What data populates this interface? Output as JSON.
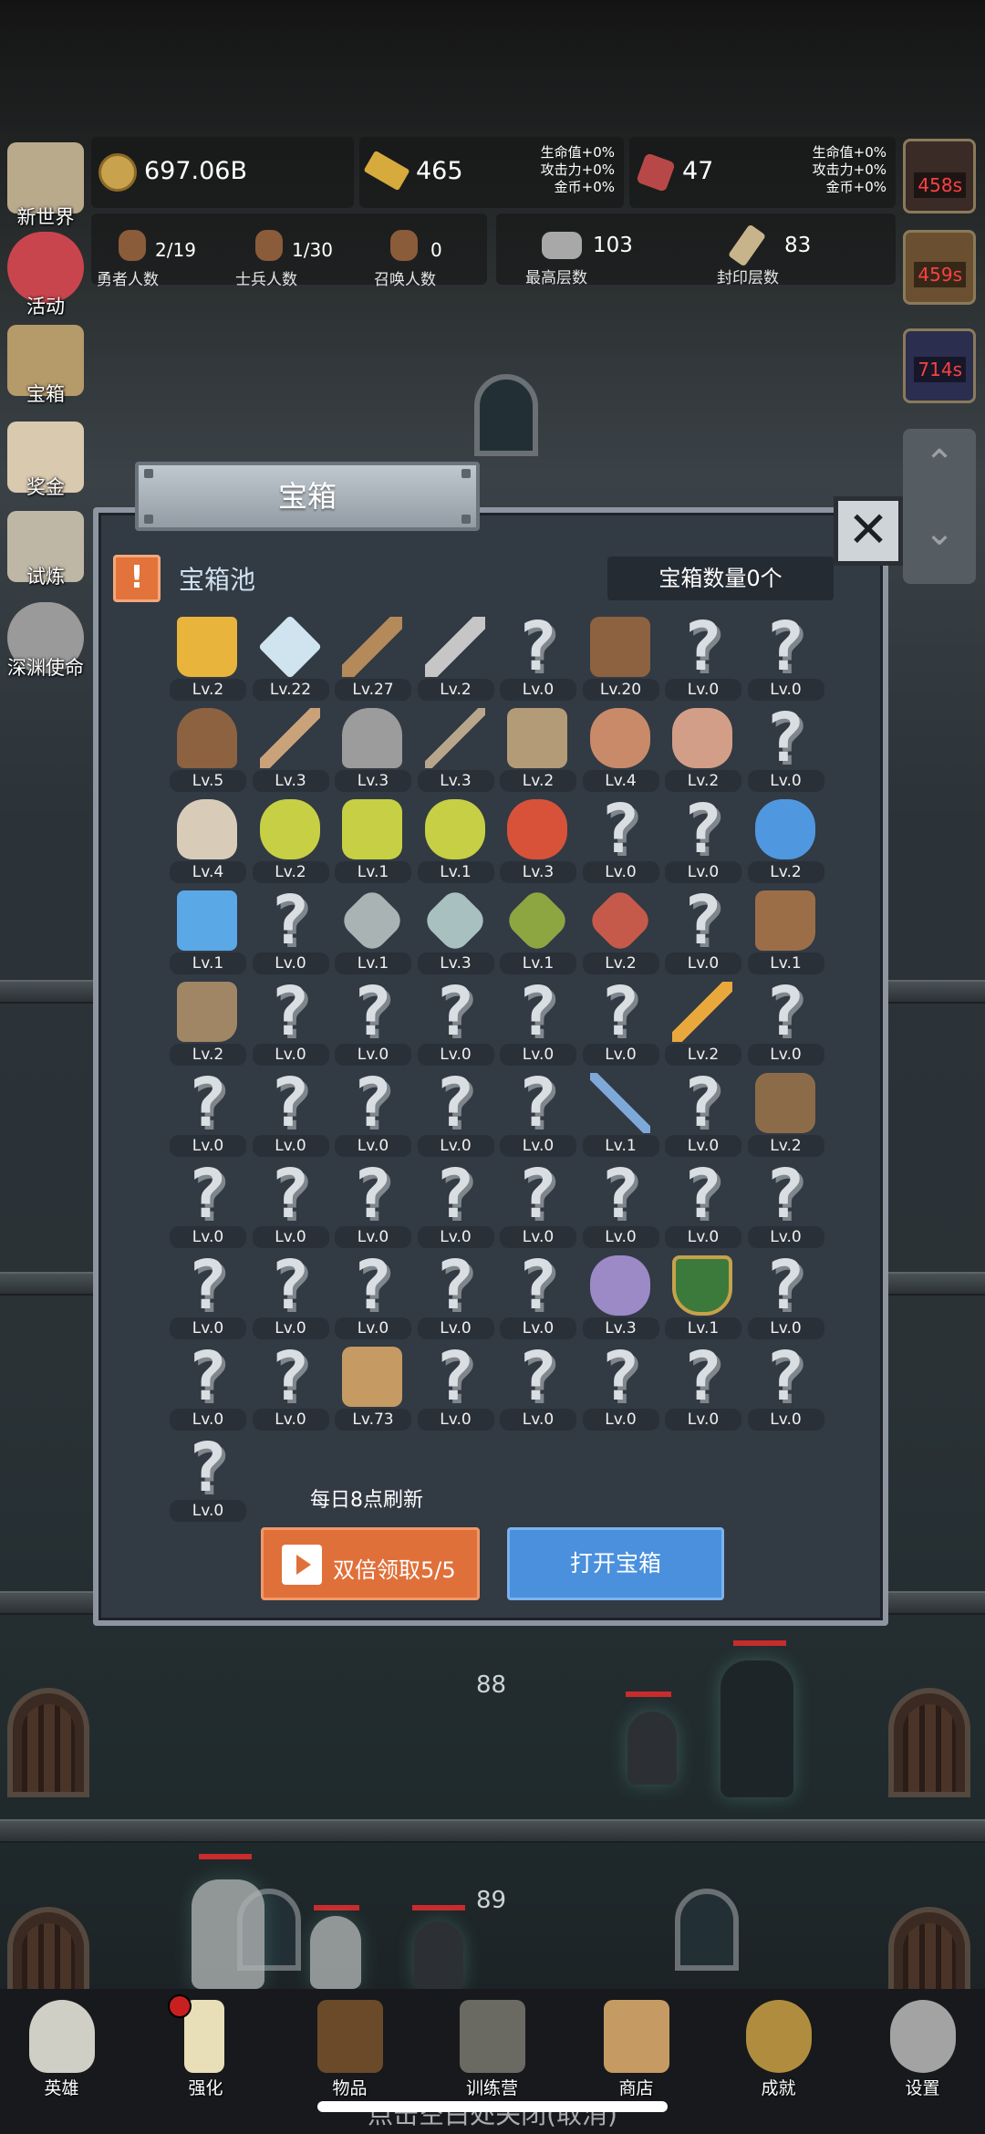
{
  "resources": {
    "gold": "697.06B",
    "gold_bar": "465",
    "gold_bar_bonus": [
      "生命值+0%",
      "攻击力+0%",
      "金币+0%"
    ],
    "gem": "47",
    "gem_bonus": [
      "生命值+0%",
      "攻击力+0%",
      "金币+0%"
    ]
  },
  "counters": [
    {
      "value": "2/19",
      "label": "勇者人数"
    },
    {
      "value": "1/30",
      "label": "士兵人数"
    },
    {
      "value": "0",
      "label": "召唤人数"
    },
    {
      "value": "103",
      "label": "最高层数"
    },
    {
      "value": "83",
      "label": "封印层数"
    }
  ],
  "side_menu": [
    "新世界",
    "活动",
    "宝箱",
    "奖金",
    "试炼",
    "深渊使命"
  ],
  "timers": [
    "458s",
    "459s",
    "714s"
  ],
  "floors": [
    "88",
    "89"
  ],
  "dialog": {
    "title": "宝箱",
    "close": "✕",
    "pool_alert": "!",
    "pool_title": "宝箱池",
    "chest_count": "宝箱数量0个",
    "refresh_note": "每日8点刷新",
    "double_button": "双倍领取5/5",
    "open_button": "打开宝箱"
  },
  "items": [
    {
      "icon": "crown",
      "level": "Lv.2"
    },
    {
      "icon": "diamond",
      "level": "Lv.22"
    },
    {
      "icon": "wood-sword",
      "level": "Lv.27"
    },
    {
      "icon": "steel-sword",
      "level": "Lv.2"
    },
    {
      "icon": "unknown",
      "level": "Lv.0"
    },
    {
      "icon": "leather-armor",
      "level": "Lv.20"
    },
    {
      "icon": "unknown",
      "level": "Lv.0"
    },
    {
      "icon": "unknown",
      "level": "Lv.0"
    },
    {
      "icon": "leather-helmet",
      "level": "Lv.5"
    },
    {
      "icon": "dagger",
      "level": "Lv.3"
    },
    {
      "icon": "knight-helmet",
      "level": "Lv.3"
    },
    {
      "icon": "hammer",
      "level": "Lv.3"
    },
    {
      "icon": "great-helm",
      "level": "Lv.2"
    },
    {
      "icon": "ham",
      "level": "Lv.4"
    },
    {
      "icon": "steak",
      "level": "Lv.2"
    },
    {
      "icon": "unknown",
      "level": "Lv.0"
    },
    {
      "icon": "bread",
      "level": "Lv.4"
    },
    {
      "icon": "yellow-potion",
      "level": "Lv.2"
    },
    {
      "icon": "yellow-flask",
      "level": "Lv.1"
    },
    {
      "icon": "yellow-round-potion",
      "level": "Lv.1"
    },
    {
      "icon": "red-potion",
      "level": "Lv.3"
    },
    {
      "icon": "unknown",
      "level": "Lv.0"
    },
    {
      "icon": "unknown",
      "level": "Lv.0"
    },
    {
      "icon": "blue-potion",
      "level": "Lv.2"
    },
    {
      "icon": "blue-flask",
      "level": "Lv.1"
    },
    {
      "icon": "unknown",
      "level": "Lv.0"
    },
    {
      "icon": "gray-vial",
      "level": "Lv.1"
    },
    {
      "icon": "gray-bottle",
      "level": "Lv.3"
    },
    {
      "icon": "green-bottle",
      "level": "Lv.1"
    },
    {
      "icon": "red-bottle",
      "level": "Lv.2"
    },
    {
      "icon": "unknown",
      "level": "Lv.0"
    },
    {
      "icon": "leather-boot",
      "level": "Lv.1"
    },
    {
      "icon": "shoe",
      "level": "Lv.2"
    },
    {
      "icon": "unknown",
      "level": "Lv.0"
    },
    {
      "icon": "unknown",
      "level": "Lv.0"
    },
    {
      "icon": "unknown",
      "level": "Lv.0"
    },
    {
      "icon": "unknown",
      "level": "Lv.0"
    },
    {
      "icon": "unknown",
      "level": "Lv.0"
    },
    {
      "icon": "torch",
      "level": "Lv.2"
    },
    {
      "icon": "unknown",
      "level": "Lv.0"
    },
    {
      "icon": "unknown",
      "level": "Lv.0"
    },
    {
      "icon": "unknown",
      "level": "Lv.0"
    },
    {
      "icon": "unknown",
      "level": "Lv.0"
    },
    {
      "icon": "unknown",
      "level": "Lv.0"
    },
    {
      "icon": "unknown",
      "level": "Lv.0"
    },
    {
      "icon": "magic-staff",
      "level": "Lv.1"
    },
    {
      "icon": "unknown",
      "level": "Lv.0"
    },
    {
      "icon": "backpack",
      "level": "Lv.2"
    },
    {
      "icon": "unknown",
      "level": "Lv.0"
    },
    {
      "icon": "unknown",
      "level": "Lv.0"
    },
    {
      "icon": "unknown",
      "level": "Lv.0"
    },
    {
      "icon": "unknown",
      "level": "Lv.0"
    },
    {
      "icon": "unknown",
      "level": "Lv.0"
    },
    {
      "icon": "unknown",
      "level": "Lv.0"
    },
    {
      "icon": "unknown",
      "level": "Lv.0"
    },
    {
      "icon": "unknown",
      "level": "Lv.0"
    },
    {
      "icon": "unknown",
      "level": "Lv.0"
    },
    {
      "icon": "unknown",
      "level": "Lv.0"
    },
    {
      "icon": "unknown",
      "level": "Lv.0"
    },
    {
      "icon": "unknown",
      "level": "Lv.0"
    },
    {
      "icon": "unknown",
      "level": "Lv.0"
    },
    {
      "icon": "rune-ring",
      "level": "Lv.3"
    },
    {
      "icon": "shield-emblem",
      "level": "Lv.1"
    },
    {
      "icon": "unknown",
      "level": "Lv.0"
    },
    {
      "icon": "unknown",
      "level": "Lv.0"
    },
    {
      "icon": "unknown",
      "level": "Lv.0"
    },
    {
      "icon": "beer-mug",
      "level": "Lv.73"
    },
    {
      "icon": "unknown",
      "level": "Lv.0"
    },
    {
      "icon": "unknown",
      "level": "Lv.0"
    },
    {
      "icon": "unknown",
      "level": "Lv.0"
    },
    {
      "icon": "unknown",
      "level": "Lv.0"
    },
    {
      "icon": "unknown",
      "level": "Lv.0"
    },
    {
      "icon": "unknown",
      "level": "Lv.0"
    }
  ],
  "bottom_nav": [
    "英雄",
    "强化",
    "物品",
    "训练营",
    "商店",
    "成就",
    "设置"
  ],
  "dismiss_hint": "点击空白处关闭(取消)"
}
